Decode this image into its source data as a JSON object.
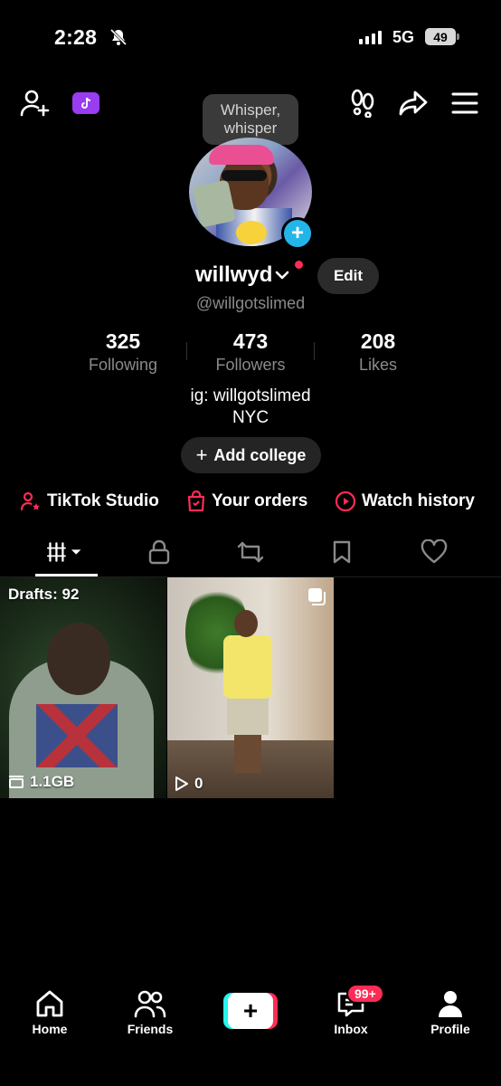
{
  "status_bar": {
    "time": "2:28",
    "network": "5G",
    "battery": "49",
    "mute_icon": "bell-slash-icon"
  },
  "header": {
    "add_friend_icon": "add-user-icon",
    "tiktok_badge_icon": "tiktok-note-icon",
    "footprint_icon": "footprints-icon",
    "share_icon": "share-arrow-icon",
    "menu_icon": "hamburger-menu-icon",
    "whisper_bubble": [
      "Whisper,",
      "whisper"
    ]
  },
  "profile": {
    "display_name": "willwyd",
    "handle": "@willgotslimed",
    "edit_label": "Edit",
    "stats": [
      {
        "value": "325",
        "label": "Following"
      },
      {
        "value": "473",
        "label": "Followers"
      },
      {
        "value": "208",
        "label": "Likes"
      }
    ],
    "bio": [
      "ig: willgotslimed",
      "NYC"
    ],
    "add_college": "Add college"
  },
  "quick_links": [
    {
      "label": "TikTok Studio",
      "icon": "studio-person-icon"
    },
    {
      "label": "Your orders",
      "icon": "shopping-bag-icon"
    },
    {
      "label": "Watch history",
      "icon": "play-circle-icon"
    }
  ],
  "content_tabs": [
    "videos",
    "private",
    "reposts",
    "favorites",
    "liked"
  ],
  "posts": [
    {
      "overlay_top": "Drafts: 92",
      "overlay_bottom": "1.1GB"
    },
    {
      "overlay_bottom": "0"
    }
  ],
  "bottom_nav": {
    "home": "Home",
    "friends": "Friends",
    "inbox": "Inbox",
    "inbox_badge": "99+",
    "profile": "Profile"
  },
  "colors": {
    "accent_red": "#fe2c55",
    "accent_cyan": "#25f4ee",
    "badge_purple": "#9a3cf0",
    "plus_blue": "#24b5e8"
  }
}
